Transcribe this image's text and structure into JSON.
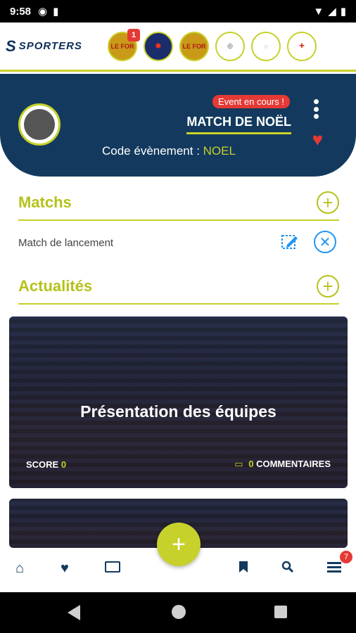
{
  "status_bar": {
    "time": "9:58"
  },
  "brand": {
    "name": "SPORTERS"
  },
  "clubs": [
    {
      "name": "LE FOR",
      "badge": "1"
    },
    {
      "name": "",
      "badge": ""
    },
    {
      "name": "LE FOR",
      "badge": ""
    },
    {
      "name": "",
      "badge": ""
    },
    {
      "name": "",
      "badge": ""
    },
    {
      "name": "",
      "badge": ""
    }
  ],
  "event": {
    "status": "Event en cours !",
    "title": "MATCH DE NOËL",
    "code_label": "Code évènement :",
    "code_value": "NOEL"
  },
  "sections": {
    "matchs": {
      "title": "Matchs"
    },
    "actualites": {
      "title": "Actualités"
    }
  },
  "matches": [
    {
      "name": "Match de lancement"
    }
  ],
  "news": [
    {
      "title": "Présentation des équipes",
      "score_label": "SCORE",
      "score_value": "0",
      "comments_value": "0",
      "comments_label": "COMMENTAIRES"
    }
  ],
  "bottom_nav": {
    "menu_badge": "7"
  },
  "icons": {
    "home": "home-icon",
    "favorite": "heart-icon",
    "event": "ticket-icon",
    "bookmark": "bookmark-icon",
    "search": "search-icon",
    "menu": "menu-icon",
    "more": "more-vert-icon",
    "add": "plus-icon",
    "edit": "edit-icon",
    "delete": "close-icon"
  },
  "colors": {
    "accent": "#c7d12b",
    "navy": "#133a5e",
    "alert": "#e53935",
    "info": "#2196f3"
  }
}
